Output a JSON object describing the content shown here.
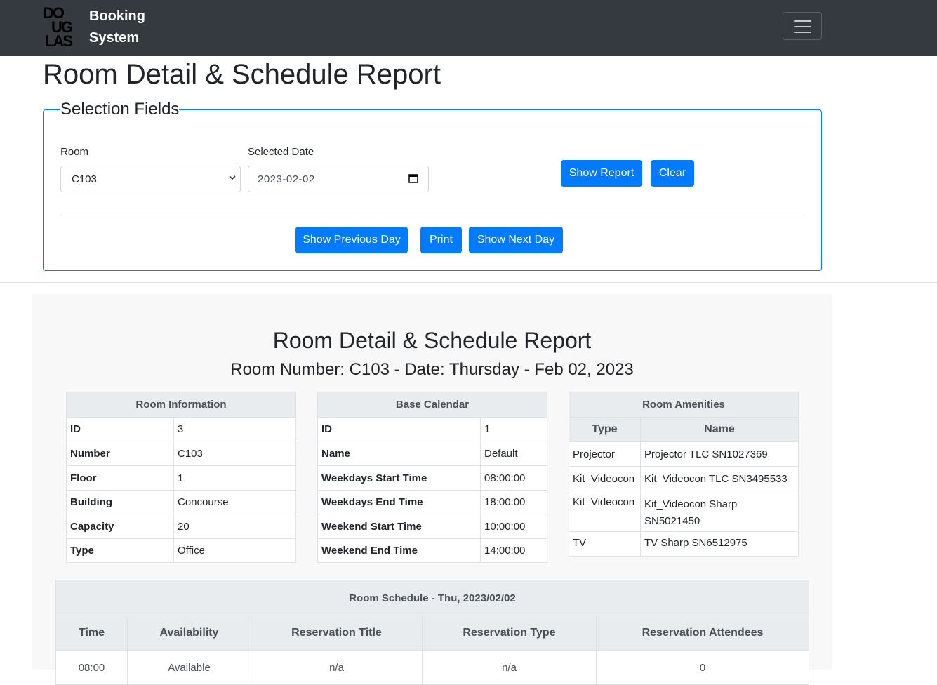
{
  "nav": {
    "logo_rows": [
      "DO",
      "UG",
      "LAS"
    ],
    "brand_line1": "Booking",
    "brand_line2": "System",
    "menu_icon": "hamburger-icon"
  },
  "page_title": "Room Detail & Schedule Report",
  "selection": {
    "legend": "Selection Fields",
    "room_label": "Room",
    "room_value": "C103",
    "date_label": "Selected Date",
    "date_value": "2023-02-02",
    "show_report": "Show Report",
    "clear": "Clear",
    "previous_day": "Show Previous Day",
    "print": "Print",
    "next_day": "Show Next Day"
  },
  "report": {
    "title": "Room Detail & Schedule Report",
    "subtitle": "Room Number: C103 - Date: Thursday - Feb 02, 2023",
    "room_info": {
      "header": "Room Information",
      "rows": [
        {
          "k": "ID",
          "v": "3"
        },
        {
          "k": "Number",
          "v": "C103"
        },
        {
          "k": "Floor",
          "v": "1"
        },
        {
          "k": "Building",
          "v": "Concourse"
        },
        {
          "k": "Capacity",
          "v": "20"
        },
        {
          "k": "Type",
          "v": "Office"
        }
      ]
    },
    "base_calendar": {
      "header": "Base Calendar",
      "rows": [
        {
          "k": "ID",
          "v": "1"
        },
        {
          "k": "Name",
          "v": "Default"
        },
        {
          "k": "Weekdays Start Time",
          "v": "08:00:00"
        },
        {
          "k": "Weekdays End Time",
          "v": "18:00:00"
        },
        {
          "k": "Weekend Start Time",
          "v": "10:00:00"
        },
        {
          "k": "Weekend End Time",
          "v": "14:00:00"
        }
      ]
    },
    "amenities": {
      "header": "Room Amenities",
      "col_type": "Type",
      "col_name": "Name",
      "rows": [
        {
          "type": "Projector",
          "name": "Projector TLC SN1027369"
        },
        {
          "type": "Kit_Videocon",
          "name": "Kit_Videocon TLC SN3495533"
        },
        {
          "type": "Kit_Videocon",
          "name": "Kit_Videocon Sharp SN5021450"
        },
        {
          "type": "TV",
          "name": "TV Sharp SN6512975"
        }
      ]
    },
    "schedule": {
      "header": "Room Schedule - Thu, 2023/02/02",
      "columns": [
        "Time",
        "Availability",
        "Reservation Title",
        "Reservation Type",
        "Reservation Attendees"
      ],
      "rows": [
        [
          "08:00",
          "Available",
          "n/a",
          "n/a",
          "0"
        ]
      ]
    }
  }
}
